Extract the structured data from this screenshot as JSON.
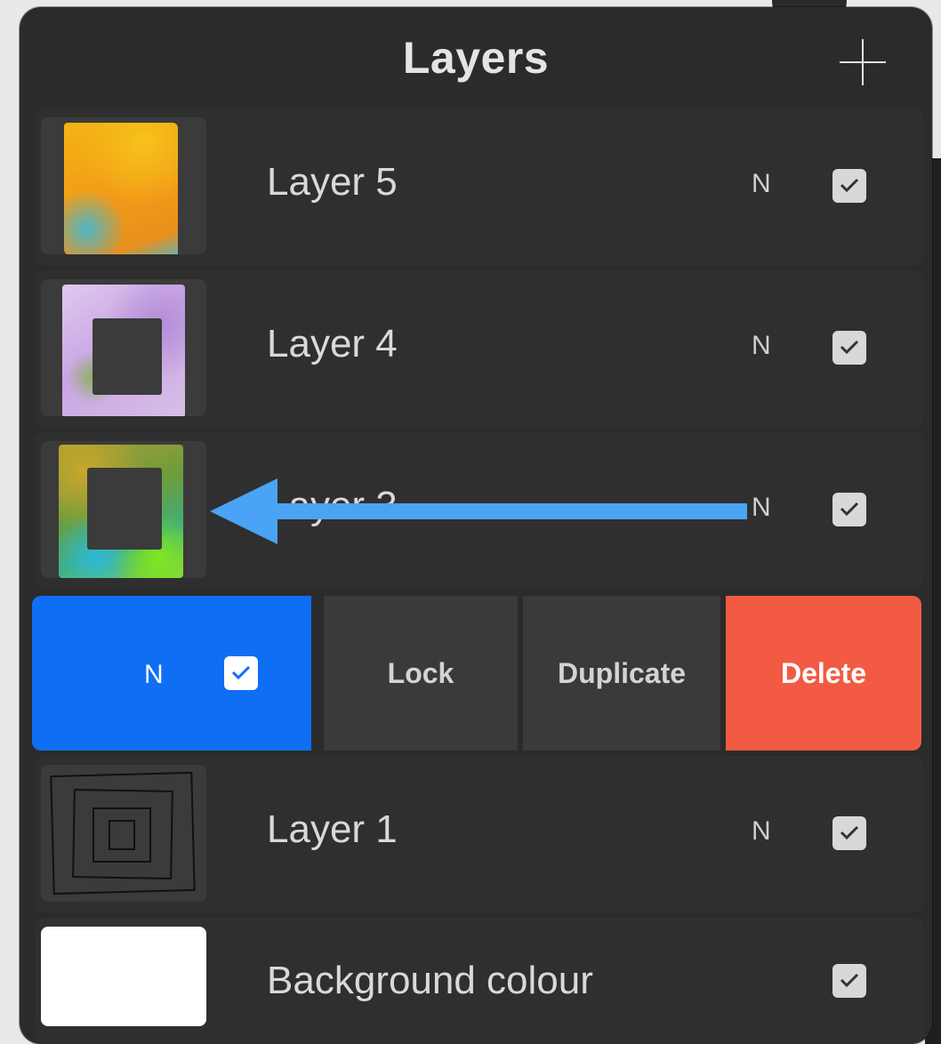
{
  "panel": {
    "title": "Layers",
    "add_icon": "plus-icon"
  },
  "layers": [
    {
      "name": "Layer 5",
      "blend": "N",
      "visible": true
    },
    {
      "name": "Layer 4",
      "blend": "N",
      "visible": true
    },
    {
      "name": "Layer 3",
      "blend": "N",
      "visible": true
    },
    {
      "name": "",
      "blend": "N",
      "visible": true,
      "selected": true
    },
    {
      "name": "Layer 1",
      "blend": "N",
      "visible": true
    },
    {
      "name": "Background colour",
      "visible": true
    }
  ],
  "actions": {
    "lock": "Lock",
    "duplicate": "Duplicate",
    "delete": "Delete"
  },
  "colors": {
    "selected": "#0e6ff5",
    "delete": "#f25a43",
    "annotation_arrow": "#4aa3f4"
  }
}
